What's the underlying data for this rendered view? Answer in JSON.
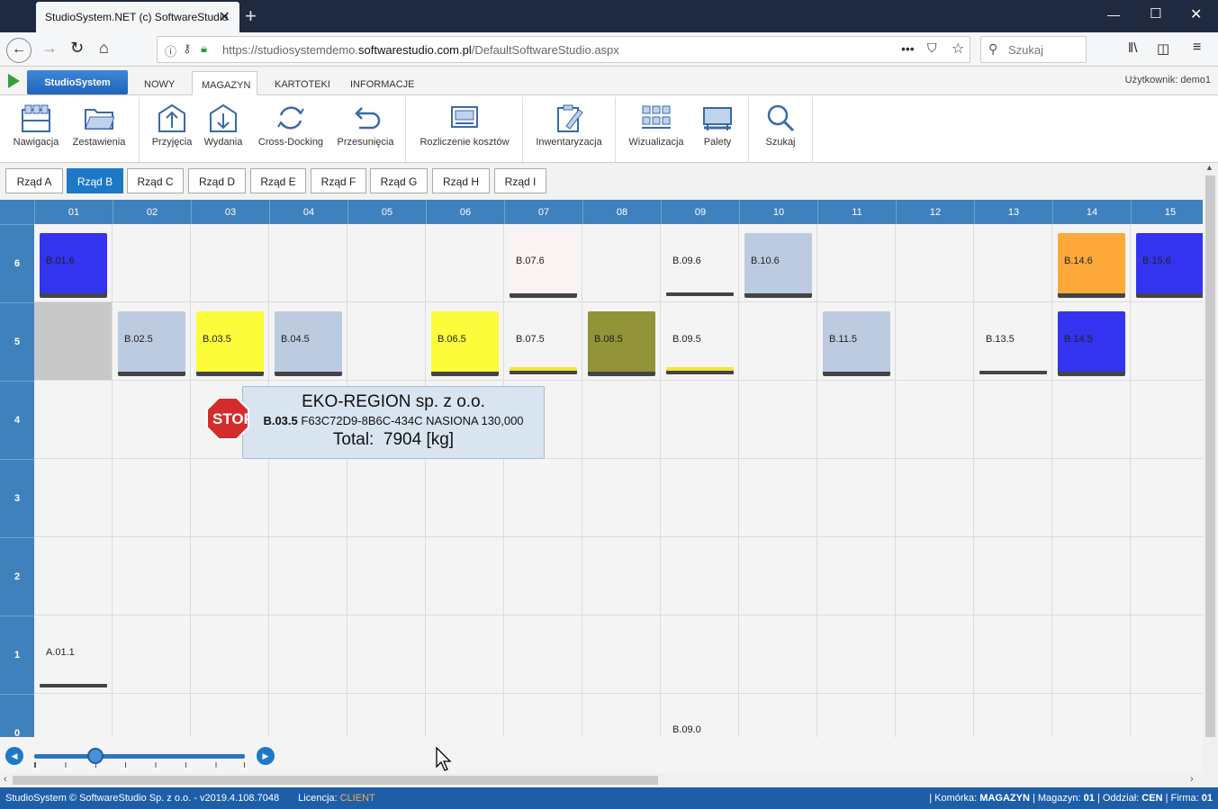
{
  "browser": {
    "tab_title": "StudioSystem.NET (c) SoftwareStudio",
    "url_prefix": "https://studiosystemdemo.",
    "url_domain": "softwarestudio.com.pl",
    "url_path": "/DefaultSoftwareStudio.aspx",
    "search_placeholder": "Szukaj"
  },
  "menu": {
    "brand": "StudioSystem",
    "tabs": [
      "NOWY",
      "MAGAZYN",
      "KARTOTEKI",
      "INFORMACJE"
    ],
    "active_tab": "MAGAZYN",
    "user": "Użytkownik: demo1"
  },
  "ribbon": [
    {
      "label": "Nawigacja",
      "icon": "warehouse-icon"
    },
    {
      "label": "Zestawienia",
      "icon": "folder-icon"
    },
    {
      "label": "Przyjęcia",
      "icon": "inbound-icon"
    },
    {
      "label": "Wydania",
      "icon": "outbound-icon"
    },
    {
      "label": "Cross-Docking",
      "icon": "refresh-icon"
    },
    {
      "label": "Przesunięcia",
      "icon": "undo-icon"
    },
    {
      "label": "Rozliczenie kosztów",
      "icon": "cash-icon"
    },
    {
      "label": "Inwentaryzacja",
      "icon": "clipboard-icon"
    },
    {
      "label": "Wizualizacja",
      "icon": "racks-icon"
    },
    {
      "label": "Palety",
      "icon": "pallet-icon"
    },
    {
      "label": "Szukaj",
      "icon": "search-icon"
    }
  ],
  "rows": [
    "Rząd A",
    "Rząd B",
    "Rząd C",
    "Rząd D",
    "Rząd E",
    "Rząd F",
    "Rząd G",
    "Rząd H",
    "Rząd I"
  ],
  "active_row": "Rząd B",
  "grid": {
    "columns": [
      "01",
      "02",
      "03",
      "04",
      "05",
      "06",
      "07",
      "08",
      "09",
      "10",
      "11",
      "12",
      "13",
      "14",
      "15"
    ],
    "levels": [
      "6",
      "5",
      "4",
      "3",
      "2",
      "1",
      "0"
    ],
    "slots": [
      {
        "label": "B.01.6",
        "col": 0,
        "level": 6,
        "color": "#3333f0"
      },
      {
        "label": "B.07.6",
        "col": 6,
        "level": 6,
        "color": "#fcf4f2"
      },
      {
        "label": "B.09.6",
        "col": 8,
        "level": 6,
        "color": "none"
      },
      {
        "label": "B.10.6",
        "col": 9,
        "level": 6,
        "color": "#bccbe0"
      },
      {
        "label": "B.14.6",
        "col": 13,
        "level": 6,
        "color": "#fca93a"
      },
      {
        "label": "B.15.6",
        "col": 14,
        "level": 6,
        "color": "#3333f0"
      },
      {
        "label": "B.02.5",
        "col": 1,
        "level": 5,
        "color": "#bccbe0"
      },
      {
        "label": "B.03.5",
        "col": 2,
        "level": 5,
        "color": "#fcfc3a"
      },
      {
        "label": "B.04.5",
        "col": 3,
        "level": 5,
        "color": "#bccbe0"
      },
      {
        "label": "B.06.5",
        "col": 5,
        "level": 5,
        "color": "#fcfc3a"
      },
      {
        "label": "B.07.5",
        "col": 6,
        "level": 5,
        "color": "none",
        "bar": "#f2e53a"
      },
      {
        "label": "B.08.5",
        "col": 7,
        "level": 5,
        "color": "#939338"
      },
      {
        "label": "B.09.5",
        "col": 8,
        "level": 5,
        "color": "none",
        "bar": "#f2e53a"
      },
      {
        "label": "B.11.5",
        "col": 10,
        "level": 5,
        "color": "#bccbe0"
      },
      {
        "label": "B.13.5",
        "col": 12,
        "level": 5,
        "color": "none"
      },
      {
        "label": "B.14.5",
        "col": 13,
        "level": 5,
        "color": "#3333f0"
      },
      {
        "label": "A.01.1",
        "col": 0,
        "level": 1,
        "color": "none"
      },
      {
        "label": "B.09.0",
        "col": 8,
        "level": 0,
        "color": "none"
      }
    ]
  },
  "tooltip": {
    "company": "EKO-REGION sp. z o.o.",
    "location": "B.03.5",
    "details": "F63C72D9-8B6C-434C NASIONA 130,000",
    "total": "Total:  7904 [kg]"
  },
  "stop_sign": "STOP",
  "status": {
    "left": "StudioSystem © SoftwareStudio Sp. z o.o. - v2019.4.108.7048",
    "license_label": "Licencja:",
    "license_value": "CLIENT",
    "cell_label": "Komórka:",
    "cell_value": "MAGAZYN",
    "warehouse_label": "Magazyn:",
    "warehouse_value": "01",
    "branch_label": "Oddział:",
    "branch_value": "CEN",
    "company_label": "Firma:",
    "company_value": "01"
  },
  "colors": {
    "accent": "#1e5ea8",
    "header": "#3f81bd",
    "active_row": "#1e78c8"
  }
}
